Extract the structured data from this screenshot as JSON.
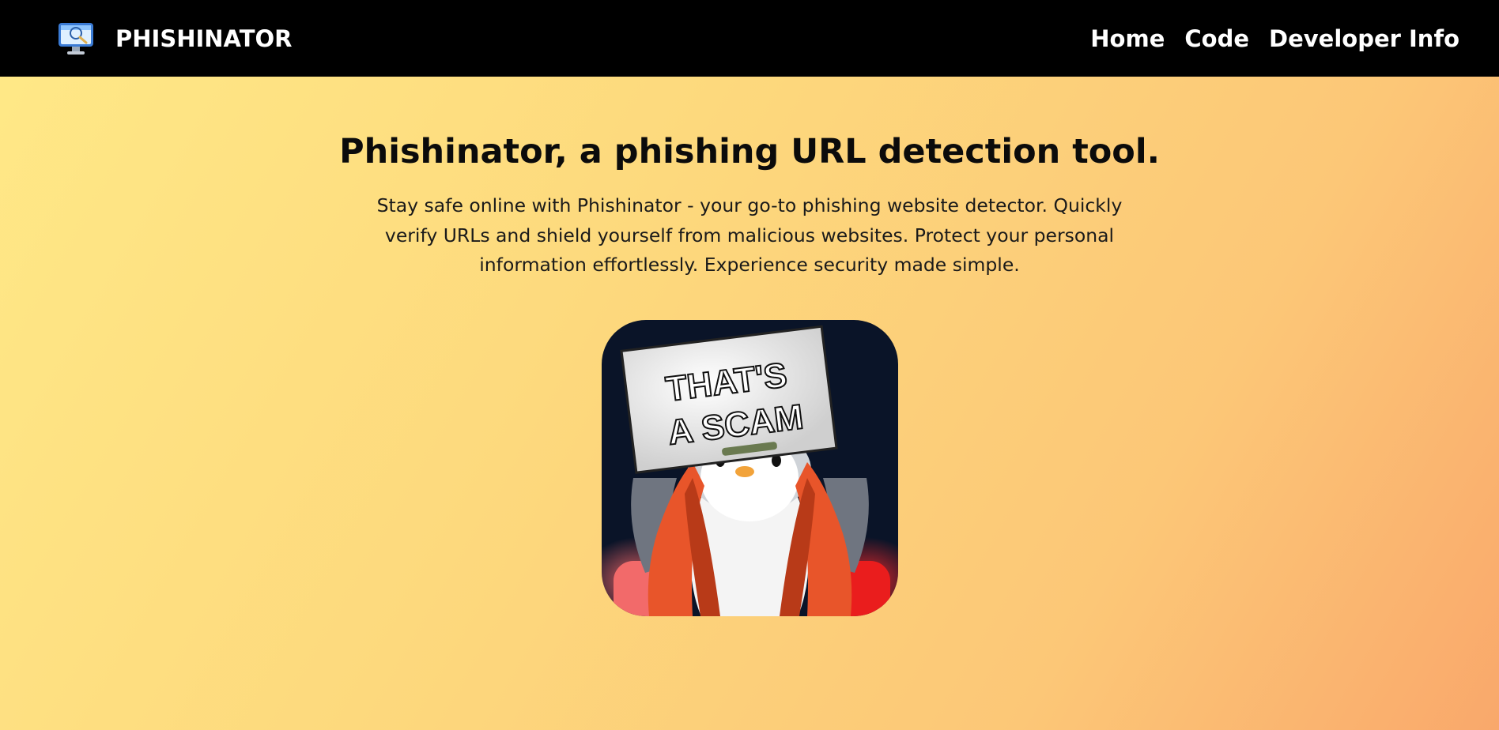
{
  "navbar": {
    "brand_name": "PHISHINATOR",
    "logo_icon": "monitor-magnifier-logo",
    "links": [
      {
        "label": "Home"
      },
      {
        "label": "Code"
      },
      {
        "label": "Developer Info"
      }
    ],
    "background_color": "#000000"
  },
  "hero": {
    "title": "Phishinator, a phishing URL detection tool.",
    "description": "Stay safe online with Phishinator - your go-to phishing website detector. Quickly verify URLs and shield yourself from malicious websites. Protect your personal information effortlessly. Experience security made simple.",
    "image": {
      "sign_line1": "THAT'S",
      "sign_line2": "A SCAM"
    }
  },
  "colors": {
    "gradient_start": "#ffe987",
    "gradient_end": "#f9a86b",
    "jacket_orange": "#e8552a",
    "image_background": "#0a1428"
  }
}
